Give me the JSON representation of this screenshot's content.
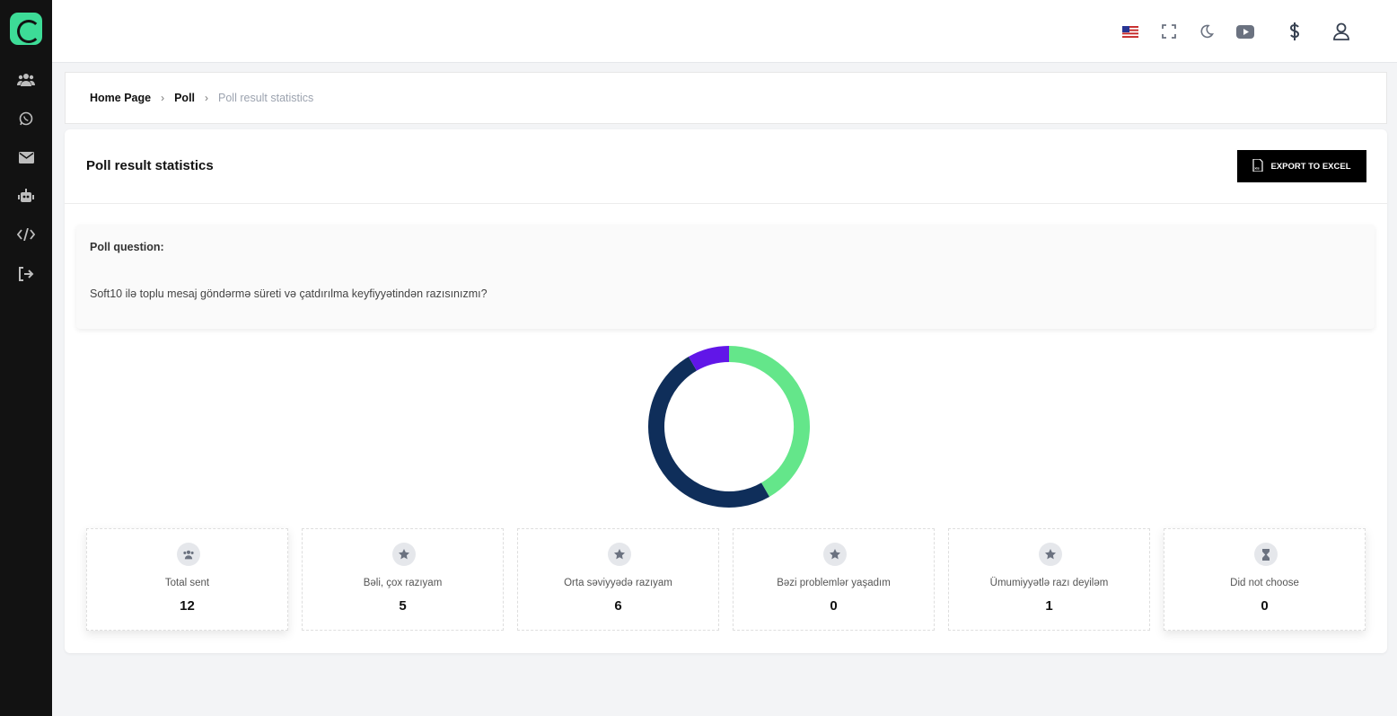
{
  "sidebar": {
    "icons": [
      "users-icon",
      "whatsapp-icon",
      "envelope-icon",
      "robot-icon",
      "code-icon",
      "logout-icon"
    ]
  },
  "topbar": {
    "icons": [
      "us-flag-icon",
      "fullscreen-icon",
      "moon-icon",
      "youtube-icon",
      "dollar-icon",
      "user-icon"
    ]
  },
  "breadcrumb": {
    "items": [
      "Home Page",
      "Poll",
      "Poll result statistics"
    ]
  },
  "page": {
    "title": "Poll result statistics",
    "export_label": "EXPORT TO EXCEL"
  },
  "question": {
    "label": "Poll question:",
    "text": "Soft10 ilə toplu mesaj göndərmə süreti və çatdırılma keyfiyyətindən razısınızmı?"
  },
  "colors": {
    "accent": "#3ddc97",
    "slice_green": "#64e68a",
    "slice_navy": "#0f2e5a",
    "slice_purple": "#6116e8"
  },
  "chart_data": {
    "type": "pie",
    "categories": [
      "Bəli, çox razıyam",
      "Orta səviyyədə razıyam",
      "Ümumiyyətlə razı deyiləm"
    ],
    "values": [
      5,
      6,
      1
    ],
    "colors": [
      "#64e68a",
      "#0f2e5a",
      "#6116e8"
    ]
  },
  "stats": [
    {
      "label": "Total sent",
      "value": "12",
      "icon": "users-icon"
    },
    {
      "label": "Bəli, çox razıyam",
      "value": "5",
      "icon": "star-icon"
    },
    {
      "label": "Orta səviyyədə razıyam",
      "value": "6",
      "icon": "star-icon"
    },
    {
      "label": "Bəzi problemlər yaşadım",
      "value": "0",
      "icon": "star-icon"
    },
    {
      "label": "Ümumiyyətlə razı deyiləm",
      "value": "1",
      "icon": "star-icon"
    },
    {
      "label": "Did not choose",
      "value": "0",
      "icon": "hourglass-icon"
    }
  ]
}
